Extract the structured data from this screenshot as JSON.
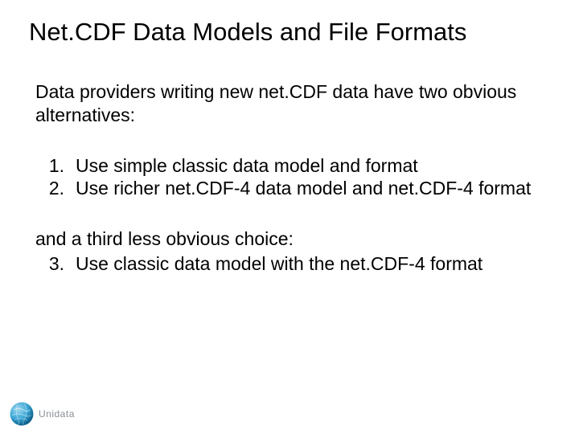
{
  "title": "Net.CDF Data Models and File Formats",
  "intro": "Data providers writing new net.CDF data  have two obvious alternatives:",
  "items": {
    "n1": "1.",
    "t1": "Use simple classic data model and format",
    "n2": "2.",
    "t2": "Use richer net.CDF-4 data model and net.CDF-4 format"
  },
  "third_intro": "and a third less obvious choice:",
  "item3": {
    "n3": "3.",
    "t3": "Use classic data model with the net.CDF-4 format"
  },
  "logo_text": "Unidata"
}
